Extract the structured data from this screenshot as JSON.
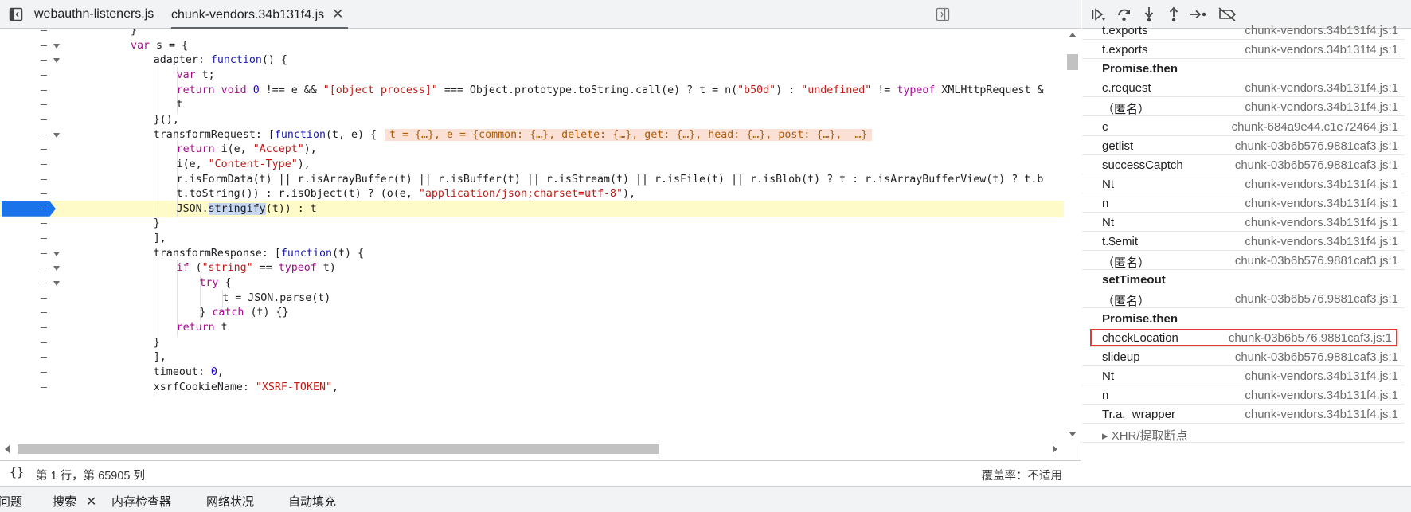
{
  "editor": {
    "tabs": [
      {
        "label": "webauthn-listeners.js"
      },
      {
        "label": "chunk-vendors.34b131f4.js",
        "active": true
      }
    ],
    "code_lines": [
      {
        "dash": "–",
        "text": "}",
        "indent": 4
      },
      {
        "dash": "–",
        "fold": true,
        "text": "var s = {",
        "indent": 4
      },
      {
        "dash": "–",
        "fold": true,
        "text": "adapter: function() {",
        "indent": 8
      },
      {
        "dash": "–",
        "text": "var t;",
        "indent": 12
      },
      {
        "dash": "–",
        "text": "return void 0 !== e && \"[object process]\" === Object.prototype.toString.call(e) ? t = n(\"b50d\") : \"undefined\" != typeof XMLHttpRequest &",
        "indent": 12
      },
      {
        "dash": "–",
        "text": "t",
        "indent": 12
      },
      {
        "dash": "–",
        "text": "}(),",
        "indent": 8
      },
      {
        "dash": "–",
        "fold": true,
        "text": "transformRequest: [function(t, e) {",
        "indent": 8,
        "inline": "t = {…}, e = {common: {…}, delete: {…}, get: {…}, head: {…}, post: {…},  …}"
      },
      {
        "dash": "–",
        "text": "return i(e, \"Accept\"),",
        "indent": 12
      },
      {
        "dash": "–",
        "text": "i(e, \"Content-Type\"),",
        "indent": 12
      },
      {
        "dash": "–",
        "text": "r.isFormData(t) || r.isArrayBuffer(t) || r.isBuffer(t) || r.isStream(t) || r.isFile(t) || r.isBlob(t) ? t : r.isArrayBufferView(t) ? t.b",
        "indent": 12
      },
      {
        "dash": "–",
        "text": "t.toString()) : r.isObject(t) ? (o(e, \"application/json;charset=utf-8\"),",
        "indent": 12
      },
      {
        "dash": "–",
        "exec": true,
        "text_before": "JSON.",
        "text_sel": "stringify",
        "text_after": "(t)) : t",
        "indent": 12
      },
      {
        "dash": "–",
        "text": "}",
        "indent": 8
      },
      {
        "dash": "–",
        "text": "],",
        "indent": 8
      },
      {
        "dash": "–",
        "fold": true,
        "text": "transformResponse: [function(t) {",
        "indent": 8
      },
      {
        "dash": "–",
        "fold": true,
        "text": "if (\"string\" == typeof t)",
        "indent": 12
      },
      {
        "dash": "–",
        "fold": true,
        "text": "try {",
        "indent": 16
      },
      {
        "dash": "–",
        "text": "t = JSON.parse(t)",
        "indent": 20
      },
      {
        "dash": "–",
        "text": "} catch (t) {}",
        "indent": 16
      },
      {
        "dash": "–",
        "text": "return t",
        "indent": 12
      },
      {
        "dash": "–",
        "text": "}",
        "indent": 8
      },
      {
        "dash": "–",
        "text": "],",
        "indent": 8
      },
      {
        "dash": "–",
        "text": "timeout: 0,",
        "indent": 8
      },
      {
        "dash": "–",
        "text": "xsrfCookieName: \"XSRF-TOKEN\",",
        "indent": 8
      }
    ],
    "status": {
      "braces": "{}",
      "position": "第 1 行，第 65905 列",
      "coverage": "覆盖率：不适用"
    }
  },
  "callstack": [
    {
      "name": "t.exports",
      "loc": "chunk-vendors.34b131f4.js:1"
    },
    {
      "name": "t.exports",
      "loc": "chunk-vendors.34b131f4.js:1"
    },
    {
      "name": "Promise.then",
      "loc": "",
      "async": true
    },
    {
      "name": "c.request",
      "loc": "chunk-vendors.34b131f4.js:1"
    },
    {
      "name": "（匿名）",
      "loc": "chunk-vendors.34b131f4.js:1"
    },
    {
      "name": "c",
      "loc": "chunk-684a9e44.c1e72464.js:1"
    },
    {
      "name": "getlist",
      "loc": "chunk-03b6b576.9881caf3.js:1"
    },
    {
      "name": "successCaptch",
      "loc": "chunk-03b6b576.9881caf3.js:1"
    },
    {
      "name": "Nt",
      "loc": "chunk-vendors.34b131f4.js:1"
    },
    {
      "name": "n",
      "loc": "chunk-vendors.34b131f4.js:1"
    },
    {
      "name": "Nt",
      "loc": "chunk-vendors.34b131f4.js:1"
    },
    {
      "name": "t.$emit",
      "loc": "chunk-vendors.34b131f4.js:1"
    },
    {
      "name": "（匿名）",
      "loc": "chunk-03b6b576.9881caf3.js:1"
    },
    {
      "name": "setTimeout",
      "loc": "",
      "async": true
    },
    {
      "name": "（匿名）",
      "loc": "chunk-03b6b576.9881caf3.js:1"
    },
    {
      "name": "Promise.then",
      "loc": "",
      "async": true
    },
    {
      "name": "checkLocation",
      "loc": "chunk-03b6b576.9881caf3.js:1",
      "highlighted": true
    },
    {
      "name": "slideup",
      "loc": "chunk-03b6b576.9881caf3.js:1"
    },
    {
      "name": "Nt",
      "loc": "chunk-vendors.34b131f4.js:1"
    },
    {
      "name": "n",
      "loc": "chunk-vendors.34b131f4.js:1"
    },
    {
      "name": "Tr.a._wrapper",
      "loc": "chunk-vendors.34b131f4.js:1"
    },
    {
      "name": "▸ XHR/提取断点",
      "loc": "",
      "cut": true
    }
  ],
  "drawer": {
    "tabs": [
      {
        "label": "问题"
      },
      {
        "label": "搜索",
        "closable": true
      },
      {
        "label": "内存检查器"
      },
      {
        "label": "网络状况"
      },
      {
        "label": "自动填充"
      }
    ]
  },
  "colors": {
    "accent": "#1a73e8",
    "exec_line": "#fffbc9",
    "highlight_outline": "#e53935"
  },
  "icons": [
    "sidebar-toggle-icon",
    "close-icon",
    "panel-toggle-icon",
    "resume-icon",
    "step-over-icon",
    "step-into-icon",
    "step-out-icon",
    "step-icon",
    "deactivate-breakpoints-icon"
  ]
}
